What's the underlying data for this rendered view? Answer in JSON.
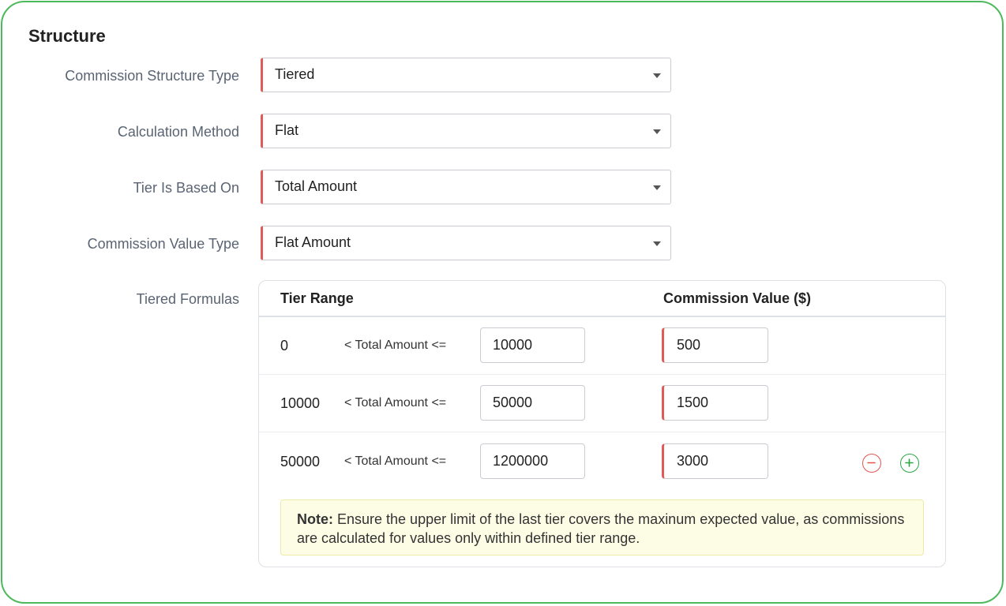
{
  "section": {
    "title": "Structure"
  },
  "fields": [
    {
      "label": "Commission Structure Type",
      "value": "Tiered"
    },
    {
      "label": "Calculation Method",
      "value": "Flat"
    },
    {
      "label": "Tier Is Based On",
      "value": "Total Amount"
    },
    {
      "label": "Commission Value Type",
      "value": "Flat Amount"
    }
  ],
  "tiered": {
    "label": "Tiered Formulas",
    "col_range": "Tier Range",
    "col_value": "Commission Value ($)",
    "operator": "< Total Amount <=",
    "rows": [
      {
        "from": "0",
        "upper": "10000",
        "value": "500"
      },
      {
        "from": "10000",
        "upper": "50000",
        "value": "1500"
      },
      {
        "from": "50000",
        "upper": "1200000",
        "value": "3000"
      }
    ],
    "note_label": "Note:",
    "note_text": " Ensure the upper limit of the last tier covers the maxinum expected value, as commissions are calculated for values only within defined tier range."
  },
  "icons": {
    "remove": "minus-circle-icon",
    "add": "plus-circle-icon"
  },
  "colors": {
    "border_accent": "#4cba5c",
    "required": "#e05a5a",
    "remove": "#e0554f",
    "add": "#28a745",
    "note_bg": "#fdfde6"
  }
}
